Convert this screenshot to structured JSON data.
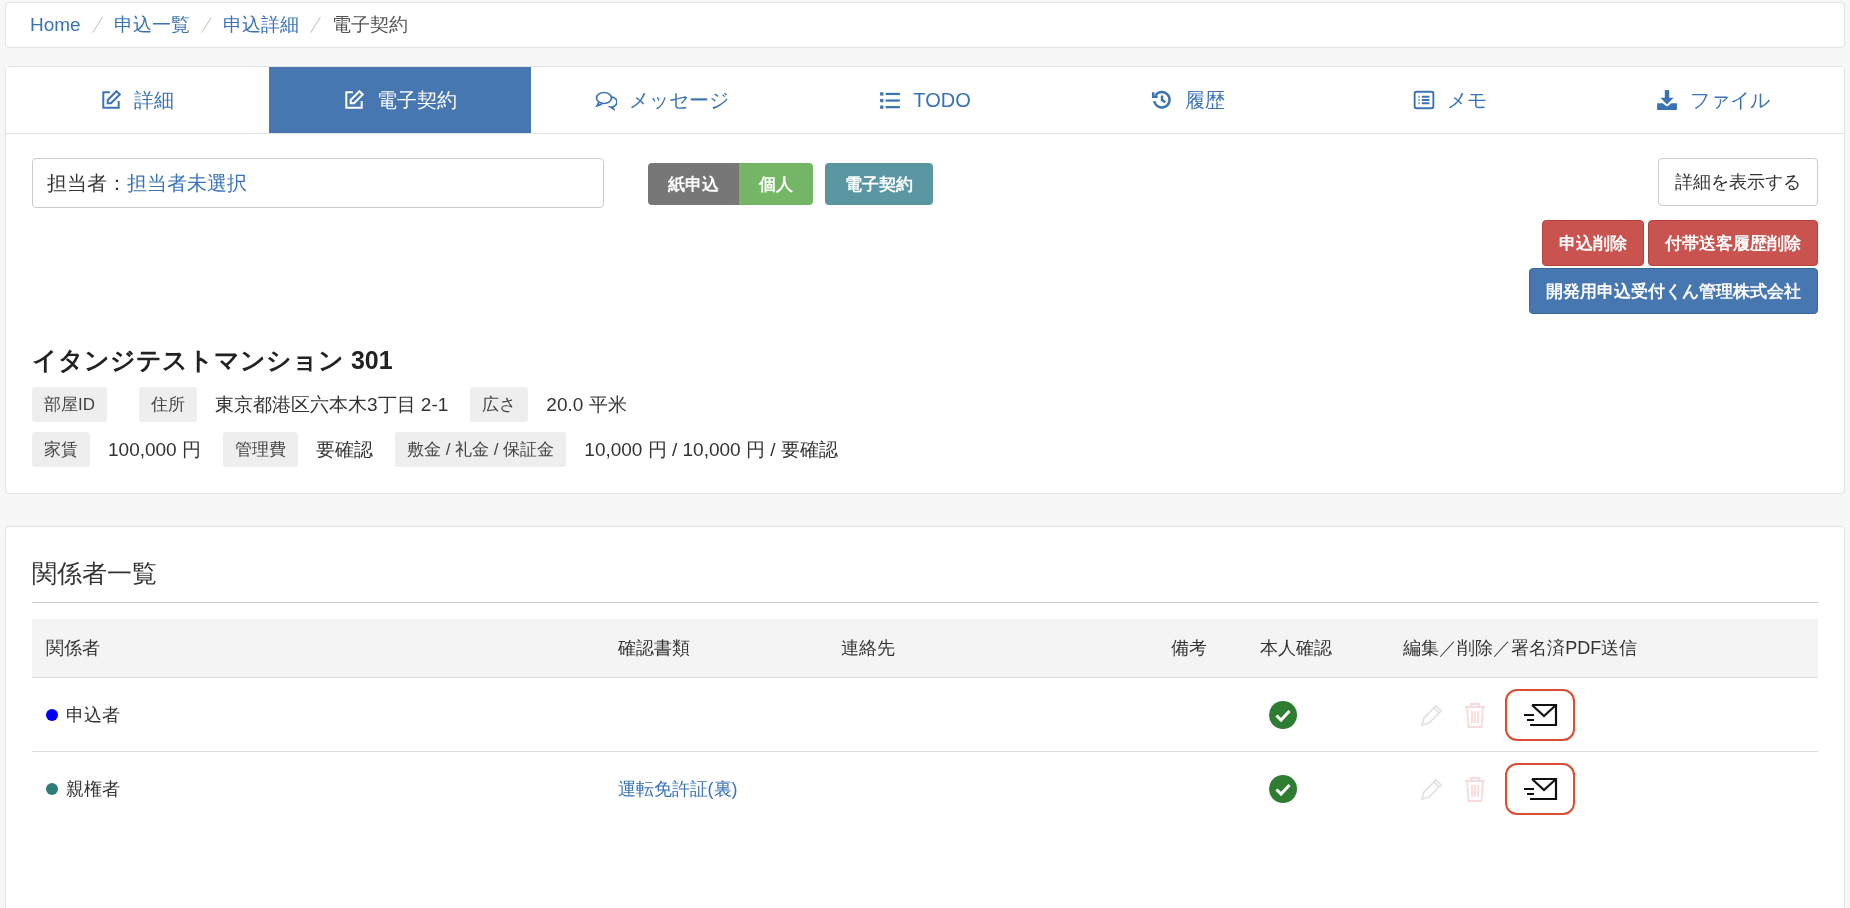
{
  "breadcrumb": [
    {
      "label": "Home",
      "current": false
    },
    {
      "label": "申込一覧",
      "current": false
    },
    {
      "label": "申込詳細",
      "current": false
    },
    {
      "label": "電子契約",
      "current": true
    }
  ],
  "tabs": [
    {
      "label": "詳細",
      "selected": false
    },
    {
      "label": "電子契約",
      "selected": true
    },
    {
      "label": "メッセージ",
      "selected": false
    },
    {
      "label": "TODO",
      "selected": false
    },
    {
      "label": "履歴",
      "selected": false
    },
    {
      "label": "メモ",
      "selected": false
    },
    {
      "label": "ファイル",
      "selected": false
    }
  ],
  "assignee": {
    "label": "担当者：",
    "value": "担当者未選択"
  },
  "badge_groups": [
    [
      {
        "label": "紙申込",
        "color": "#777777"
      },
      {
        "label": "個人",
        "color": "#74b566"
      }
    ],
    [
      {
        "label": "電子契約",
        "color": "#5a97a3"
      }
    ]
  ],
  "detail_button": "詳細を表示する",
  "danger_buttons": [
    "申込削除",
    "付帯送客履歴削除"
  ],
  "company_button": "開発用申込受付くん管理株式会社",
  "property": {
    "title": "イタンジテストマンション 301",
    "rows": [
      [
        {
          "label": "部屋ID"
        },
        {
          "label": "住所",
          "value": "東京都港区六本木3丁目 2-1"
        },
        {
          "label": "広さ",
          "value": "20.0 平米"
        }
      ],
      [
        {
          "label": "家賃",
          "value": "100,000 円"
        },
        {
          "label": "管理費",
          "value": "要確認"
        },
        {
          "label": "敷金 / 礼金 / 保証金",
          "value": "10,000 円 / 10,000 円 / 要確認"
        }
      ]
    ]
  },
  "parties": {
    "title": "関係者一覧",
    "columns": [
      "関係者",
      "確認書類",
      "連絡先",
      "備考",
      "本人確認",
      "編集／削除／署名済PDF送信"
    ],
    "rows": [
      {
        "name": "申込者",
        "color": "#0000ff",
        "verified": true,
        "edit_disabled": true,
        "delete_disabled": true
      },
      {
        "name": "親権者",
        "color": "#2e7d7a",
        "document": "運転免許証(裏)",
        "verified": true,
        "edit_disabled": true,
        "delete_disabled": true
      }
    ]
  }
}
